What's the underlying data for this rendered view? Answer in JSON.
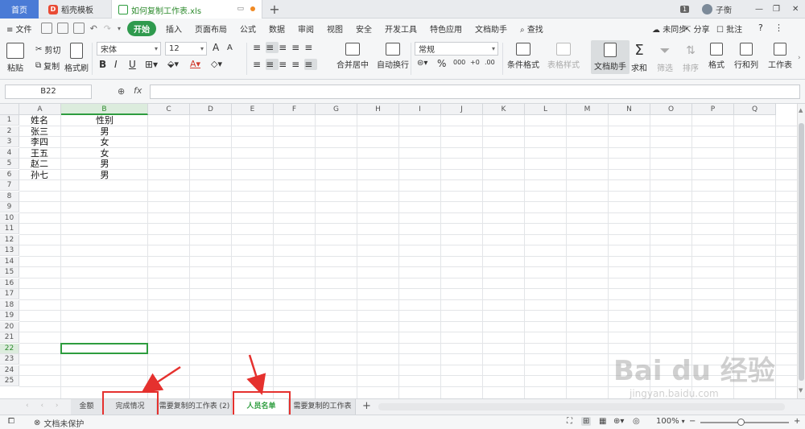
{
  "titlebar": {
    "home_tab": "首页",
    "templates_tab": "稻壳模板",
    "file_tab": "如何复制工作表.xls",
    "plus": "+",
    "badge": "1",
    "user": "子衡",
    "win_min": "—",
    "win_restore": "❐",
    "win_close": "✕"
  },
  "menubar": {
    "file": "≡ 文件",
    "items": [
      "开始",
      "插入",
      "页面布局",
      "公式",
      "数据",
      "审阅",
      "视图",
      "安全",
      "开发工具",
      "特色应用",
      "文档助手"
    ],
    "search": "查找",
    "sync": "未同步",
    "share": "分享",
    "comment": "批注",
    "help": "?",
    "more": "⋮"
  },
  "ribbon": {
    "paste": "粘贴",
    "cut": "剪切",
    "copy": "复制",
    "format_painter": "格式刷",
    "font_name": "宋体",
    "font_size": "12",
    "merge_center": "合并居中",
    "wrap_text": "自动换行",
    "number_format": "常规",
    "conditional_format": "条件格式",
    "table_style": "表格样式",
    "doc_assistant": "文档助手",
    "sum": "求和",
    "filter": "筛选",
    "sort": "排序",
    "format": "格式",
    "row_col": "行和列",
    "worksheet": "工作表",
    "bold": "B",
    "italic": "I",
    "underline": "U",
    "percent": "%",
    "thousands": "000",
    "font_grow": "A",
    "font_shrink": "A"
  },
  "formulabar": {
    "namebox": "B22",
    "fx": "fx",
    "value": ""
  },
  "grid": {
    "columns": [
      "A",
      "B",
      "C",
      "D",
      "E",
      "F",
      "G",
      "H",
      "I",
      "J",
      "K",
      "L",
      "M",
      "N",
      "O",
      "P",
      "Q"
    ],
    "rows": [
      "1",
      "2",
      "3",
      "4",
      "5",
      "6",
      "7",
      "8",
      "9",
      "10",
      "11",
      "12",
      "13",
      "14",
      "15",
      "16",
      "17",
      "18",
      "19",
      "20",
      "21",
      "22",
      "23",
      "24",
      "25"
    ],
    "cells": [
      [
        "姓名",
        "性别"
      ],
      [
        "张三",
        "男"
      ],
      [
        "李四",
        "女"
      ],
      [
        "王五",
        "女"
      ],
      [
        "赵二",
        "男"
      ],
      [
        "孙七",
        "男"
      ]
    ],
    "selected_cell": "B22"
  },
  "sheets": {
    "tabs": [
      "金额",
      "完成情况",
      "需要复制的工作表 (2)",
      "人员名单",
      "需要复制的工作表"
    ],
    "active": "人员名单",
    "add": "+"
  },
  "statusbar": {
    "protect": "文档未保护",
    "zoom": "100%",
    "zoom_minus": "−",
    "zoom_plus": "+",
    "zoom_level": 0.45
  },
  "watermark": {
    "brand": "Bai du 经验",
    "url": "jingyan.baidu.com"
  },
  "colors": {
    "accent_green": "#2e9d3f",
    "highlight_red": "#e5312e",
    "home_blue": "#4a7bd6"
  }
}
